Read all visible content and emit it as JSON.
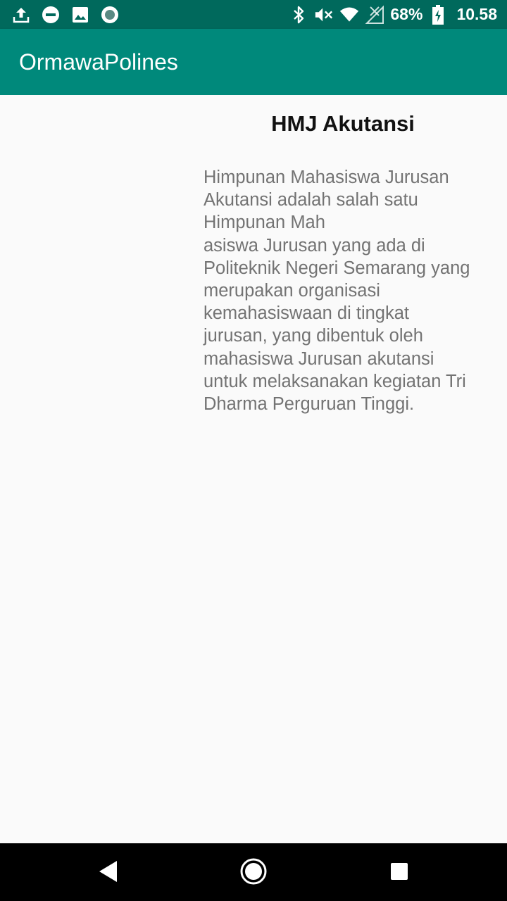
{
  "status_bar": {
    "left_icons": [
      "upload-icon",
      "do-not-disturb-icon",
      "image-icon",
      "record-icon"
    ],
    "right_icons": [
      "bluetooth-icon",
      "volume-muted-icon",
      "wifi-icon",
      "no-signal-icon",
      "battery-charging-icon"
    ],
    "battery": "68%",
    "time": "10.58"
  },
  "app_bar": {
    "title": "OrmawaPolines",
    "color": "#00897b"
  },
  "content": {
    "title": "HMJ Akutansi",
    "description_lines": [
      "Himpunan Mahasiswa Jurusan",
      "Akutansi adalah salah satu",
      "Himpunan Mah",
      "asiswa Jurusan yang ada di",
      "Politeknik Negeri Semarang yang",
      "merupakan organisasi",
      "kemahasiswaan di tingkat",
      "jurusan, yang dibentuk oleh",
      "mahasiswa Jurusan akutansi",
      "untuk melaksanakan kegiatan Tri",
      "Dharma Perguruan Tinggi."
    ]
  },
  "nav_bar": {
    "buttons": [
      "back-icon",
      "home-icon",
      "recents-icon"
    ]
  },
  "colors": {
    "status_bar": "#00695c",
    "app_bar": "#00897b",
    "background": "#fafafa",
    "description_text": "#737373"
  }
}
